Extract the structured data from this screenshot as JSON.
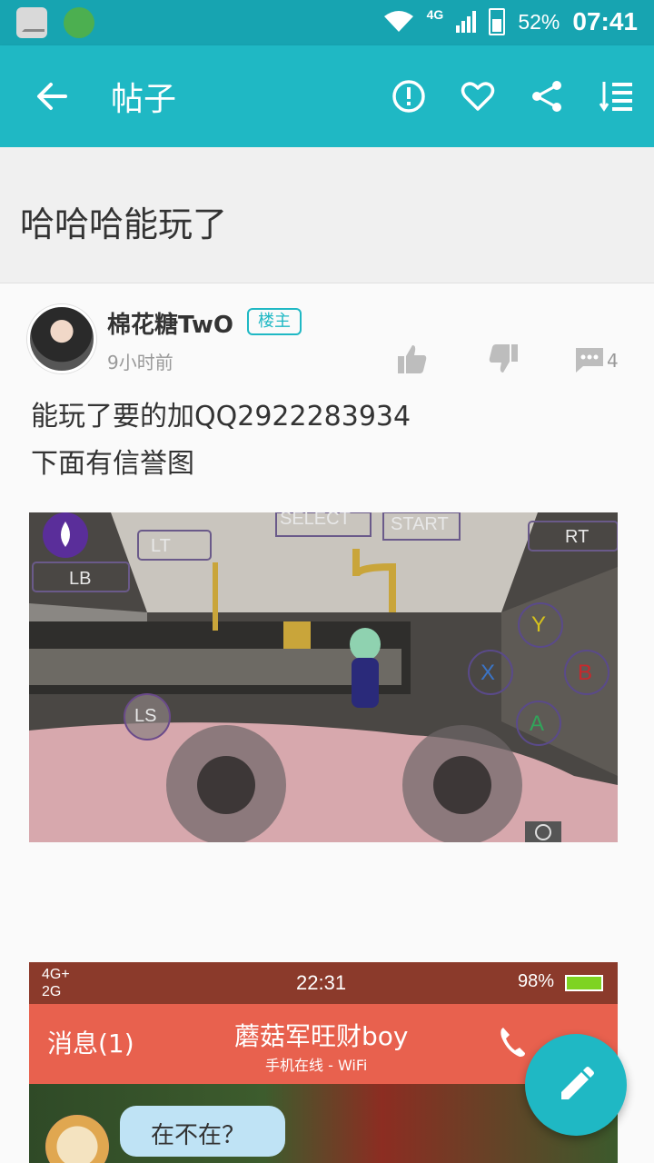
{
  "status_bar": {
    "network_label": "4G",
    "battery": "52%",
    "time": "07:41"
  },
  "app_bar": {
    "title": "帖子",
    "icons": [
      "back-arrow-icon",
      "report-icon",
      "favorite-heart-icon",
      "share-icon",
      "sort-list-icon"
    ]
  },
  "post": {
    "title": "哈哈哈能玩了",
    "author": "棉花糖TwO",
    "author_badge": "楼主",
    "time_ago": "9小时前",
    "comment_count": "4",
    "body_lines": [
      "能玩了要的加QQ2922283934",
      "下面有信誉图"
    ]
  },
  "image1": {
    "buttons": {
      "select": "SELECT",
      "start": "START",
      "lt": "LT",
      "rt": "RT",
      "lb": "LB",
      "ls": "LS",
      "y": "Y",
      "x": "X",
      "b": "B",
      "a": "A"
    },
    "colors": {
      "y": "#d6c21c",
      "x": "#3b74c6",
      "b": "#c8282c",
      "a": "#32a35a"
    }
  },
  "image2": {
    "status_net": "4G+ 2G",
    "status_net_top": "4G+",
    "status_net_bottom": "2G",
    "status_time": "22:31",
    "status_battery": "98%",
    "back_label": "消息(1)",
    "contact_name": "蘑菇军旺财boy",
    "contact_status": "手机在线 - WiFi",
    "message": "在不在？"
  },
  "colors": {
    "accent": "#1fb8c4",
    "status_bar": "#17a4b1"
  }
}
